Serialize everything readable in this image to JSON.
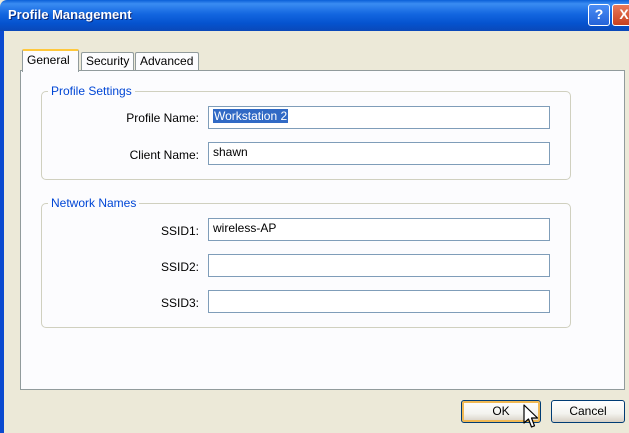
{
  "window": {
    "title": "Profile Management",
    "help_label": "?",
    "close_label": "X"
  },
  "tabs": [
    {
      "label": "General",
      "active": true
    },
    {
      "label": "Security",
      "active": false
    },
    {
      "label": "Advanced",
      "active": false
    }
  ],
  "profile_settings": {
    "title": "Profile Settings",
    "profile_name_label": "Profile Name:",
    "profile_name_value": "Workstation 2",
    "client_name_label": "Client Name:",
    "client_name_value": "shawn"
  },
  "network_names": {
    "title": "Network Names",
    "ssid1_label": "SSID1:",
    "ssid1_value": "wireless-AP",
    "ssid2_label": "SSID2:",
    "ssid2_value": "",
    "ssid3_label": "SSID3:",
    "ssid3_value": ""
  },
  "buttons": {
    "ok_label": "OK",
    "cancel_label": "Cancel"
  },
  "colors": {
    "title_bar": "#0553cf",
    "group_title": "#0046d5",
    "selection": "#316ac5",
    "active_tab_accent": "#ffc83c"
  }
}
